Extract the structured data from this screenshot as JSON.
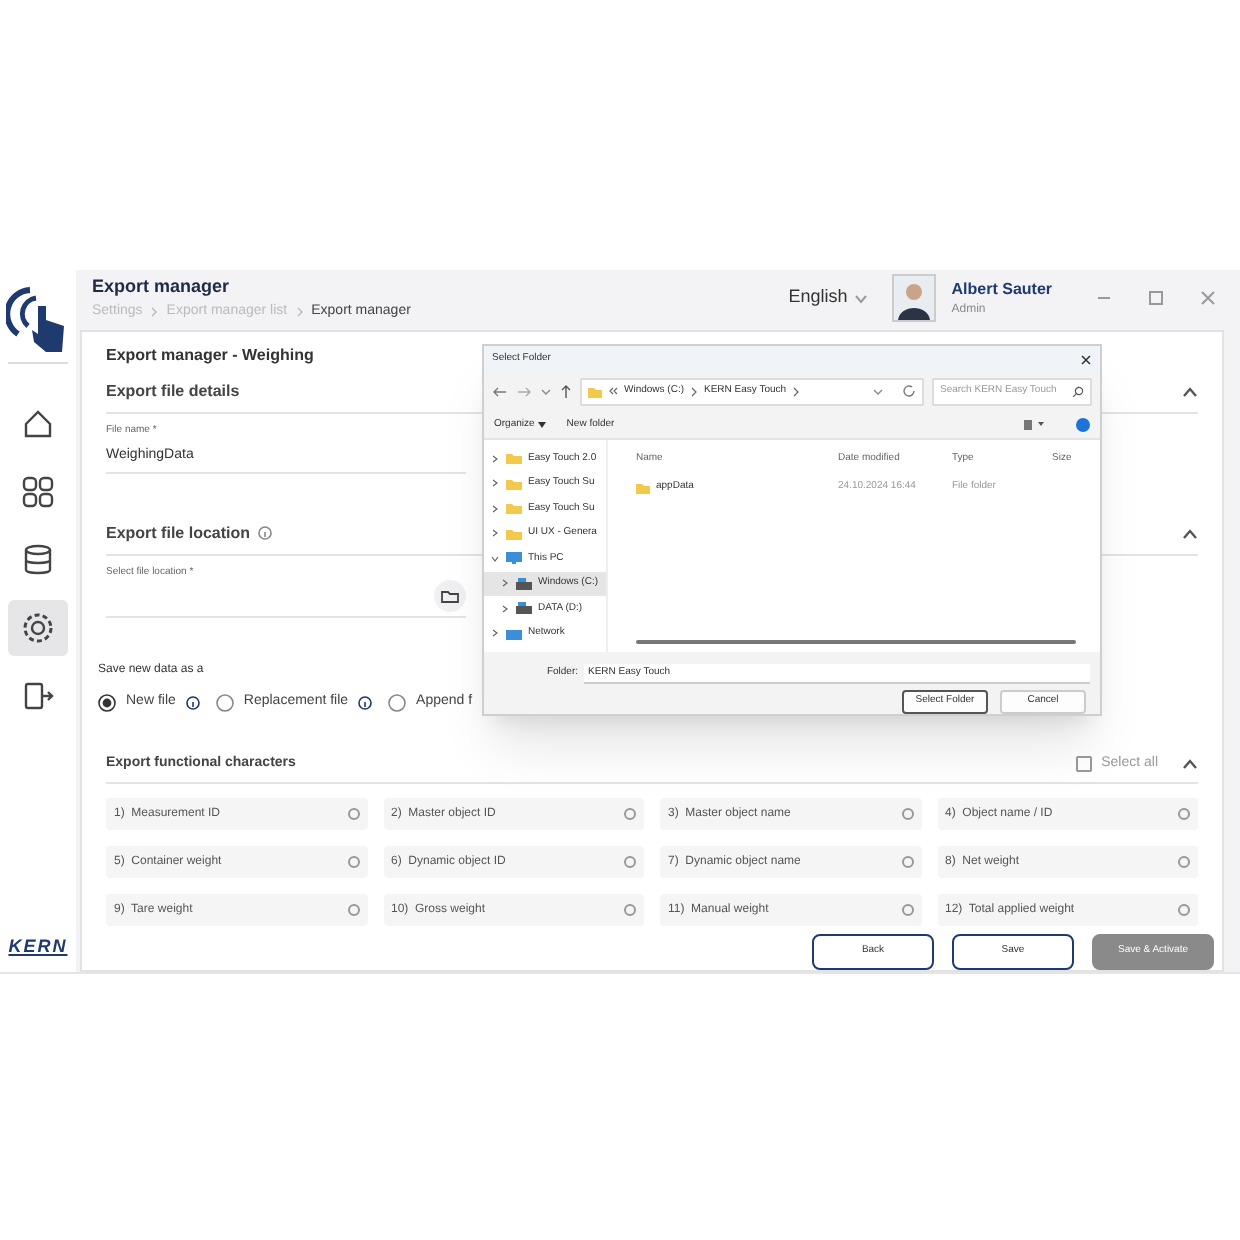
{
  "header": {
    "title": "Export manager",
    "breadcrumb": [
      "Settings",
      "Export manager list",
      "Export manager"
    ],
    "language": "English",
    "user": {
      "name": "Albert Sauter",
      "role": "Admin"
    }
  },
  "sidebar": {
    "items": [
      {
        "kind": "home",
        "selected": false
      },
      {
        "kind": "grid",
        "selected": false
      },
      {
        "kind": "database",
        "selected": false
      },
      {
        "kind": "gear",
        "selected": true
      },
      {
        "kind": "exit",
        "selected": false
      }
    ],
    "logo": "KERN"
  },
  "form": {
    "title": "Export manager - Weighing",
    "details": {
      "heading": "Export file details",
      "field": {
        "label": "File name *",
        "value": "WeighingData"
      }
    },
    "location": {
      "heading": "Export file location",
      "field": {
        "label": "Select file location *"
      }
    },
    "save_as": {
      "label": "Save new data as a",
      "options": [
        {
          "label": "New file",
          "selected": true,
          "info": true
        },
        {
          "label": "Replacement file",
          "selected": false,
          "info": true
        },
        {
          "label": "Append f",
          "selected": false,
          "info": false
        }
      ]
    },
    "characters": {
      "heading": "Export functional characters",
      "select_all": {
        "label": "Select all",
        "checked": false
      },
      "items": [
        {
          "label": "1)  Measurement ID",
          "checked": false
        },
        {
          "label": "2)  Master object ID",
          "checked": false
        },
        {
          "label": "3)  Master object name",
          "checked": false
        },
        {
          "label": "4)  Object name / ID",
          "checked": false
        },
        {
          "label": "5)  Container weight",
          "checked": false
        },
        {
          "label": "6)  Dynamic object ID",
          "checked": false
        },
        {
          "label": "7)  Dynamic object name",
          "checked": false
        },
        {
          "label": "8)  Net weight",
          "checked": false
        },
        {
          "label": "9)  Tare weight",
          "checked": false
        },
        {
          "label": "10)  Gross weight",
          "checked": false
        },
        {
          "label": "11)  Manual weight",
          "checked": false
        },
        {
          "label": "12)  Total applied weight",
          "checked": false
        }
      ]
    },
    "buttons": [
      {
        "label": "Back",
        "kind": "outline"
      },
      {
        "label": "Save",
        "kind": "outline"
      },
      {
        "label": "Save & Activate",
        "kind": "filled"
      }
    ]
  },
  "dialog": {
    "title": "Select Folder",
    "path": [
      "Windows (C:)",
      "KERN Easy Touch"
    ],
    "search": {
      "placeholder": "Search KERN Easy Touch"
    },
    "toolbar": {
      "organize": "Organize",
      "new_folder": "New folder"
    },
    "tree": [
      {
        "label": "Easy Touch 2.0",
        "kind": "folder",
        "expanded": false,
        "selected": false
      },
      {
        "label": "Easy Touch Su",
        "kind": "folder",
        "expanded": false,
        "selected": false
      },
      {
        "label": "Easy Touch Su",
        "kind": "folder",
        "expanded": false,
        "selected": false
      },
      {
        "label": "UI UX - Genera",
        "kind": "folder",
        "expanded": false,
        "selected": false
      },
      {
        "label": "This PC",
        "kind": "pc",
        "expanded": true,
        "selected": false,
        "children": [
          {
            "label": "Windows (C:)",
            "kind": "drive",
            "expanded": false,
            "selected": true
          },
          {
            "label": "DATA (D:)",
            "kind": "drive",
            "expanded": false,
            "selected": false
          }
        ]
      },
      {
        "label": "Network",
        "kind": "network",
        "expanded": false,
        "selected": false
      }
    ],
    "columns": [
      "Name",
      "Date modified",
      "Type",
      "Size"
    ],
    "rows": [
      {
        "name": "appData",
        "date": "24.10.2024 16:44",
        "type": "File folder"
      }
    ],
    "folder": {
      "label": "Folder:",
      "value": "KERN Easy Touch"
    },
    "buttons": [
      {
        "label": "Select Folder",
        "kind": "default"
      },
      {
        "label": "Cancel",
        "kind": "normal"
      }
    ]
  }
}
